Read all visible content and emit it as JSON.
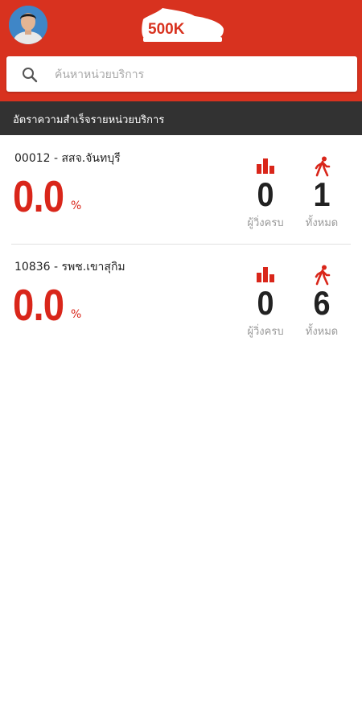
{
  "header": {
    "logo_text": "500K"
  },
  "search": {
    "placeholder": "ค้นหาหน่วยบริการ",
    "value": ""
  },
  "section": {
    "title": "อัตราความสำเร็จรายหน่วยบริการ"
  },
  "units": [
    {
      "name": "00012 - สสจ.จันทบุรี",
      "rate": "0.0",
      "percent_sign": "%",
      "finished_value": "0",
      "finished_label": "ผู้วิ่งครบ",
      "total_value": "1",
      "total_label": "ทั้งหมด"
    },
    {
      "name": "10836 - รพช.เขาสุกิม",
      "rate": "0.0",
      "percent_sign": "%",
      "finished_value": "0",
      "finished_label": "ผู้วิ่งครบ",
      "total_value": "6",
      "total_label": "ทั้งหมด"
    }
  ],
  "colors": {
    "brand_red": "#d8321f",
    "section_dark": "#323232",
    "rate_red": "#d9261a"
  },
  "icons": {
    "finished": "bar-chart-icon",
    "total": "walking-person-icon",
    "search": "search-icon"
  }
}
